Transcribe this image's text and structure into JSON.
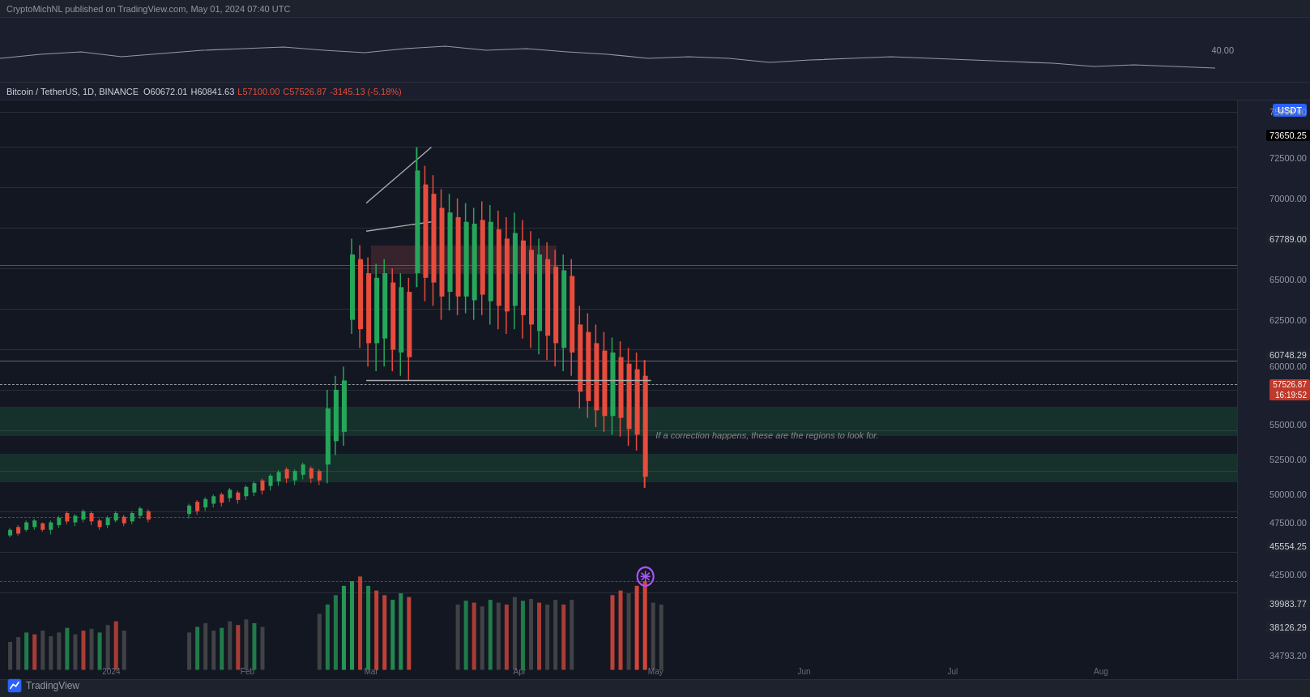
{
  "topBar": {
    "text": "CryptoMichNL published on TradingView.com, May 01, 2024 07:40 UTC"
  },
  "symbolInfo": {
    "symbol": "Bitcoin / TetherUS, 1D, BINANCE",
    "open": "O60672.01",
    "high": "H60841.63",
    "low": "L57100.00",
    "close": "C57526.87",
    "change": "-3145.13 (-5.18%)"
  },
  "priceLabels": {
    "p75000": "75000.00",
    "p73650": "73650.25",
    "p72500": "72500.00",
    "p70000": "70000.00",
    "p67789": "67789.00",
    "p65000": "65000.00",
    "p62500": "62500.00",
    "p60748": "60748.29",
    "p60000": "60000.00",
    "p57526": "57526.87",
    "p57526time": "16:19:52",
    "p55000": "55000.00",
    "p52500": "52500.00",
    "p50000": "50000.00",
    "p47500": "47500.00",
    "p45554": "45554.25",
    "p42500": "42500.00",
    "p39983": "39983.77",
    "p38126": "38126.29",
    "p34793": "34793.20"
  },
  "timeLabels": [
    "2024",
    "Feb",
    "Mar",
    "Apr",
    "May",
    "Jun",
    "Jul",
    "Aug"
  ],
  "annotation": "If a correction happens, these are the regions to look for.",
  "usdt": "USDT",
  "tvBrand": "TradingView",
  "bitcoin": "Bitcoin"
}
